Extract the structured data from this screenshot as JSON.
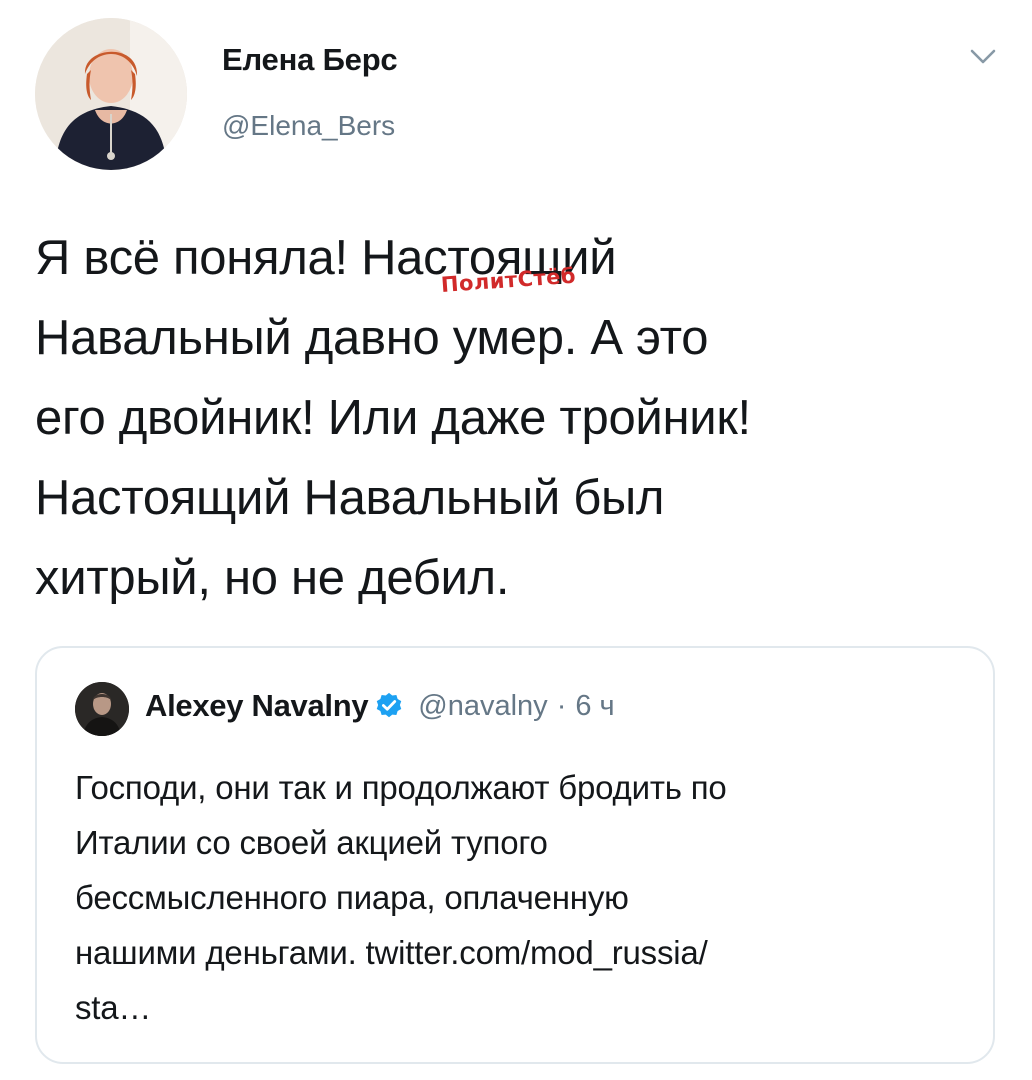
{
  "author": {
    "display_name": "Елена Берс",
    "handle": "@Elena_Bers"
  },
  "tweet": {
    "text": "Я всё поняла! Настоящий\nНавальный давно умер. А это\nего двойник! Или даже тройник!\nНастоящий Навальный был\nхитрый, но не дебил."
  },
  "watermark": {
    "text": "ПолитСтёб",
    "color": "#d12a2a"
  },
  "quoted_tweet": {
    "display_name": "Alexey Navalny",
    "handle": "@navalny",
    "separator": "·",
    "time": "6 ч",
    "text": "Господи, они так и продолжают бродить по\nИталии со своей акцией тупого\nбессмысленного пиара, оплаченную\nнашими деньгами. twitter.com/mod_russia/\nsta…",
    "verified_icon": "verified-badge-icon"
  },
  "icons": {
    "menu": "chevron-down-icon",
    "author_avatar": "avatar",
    "quoted_avatar": "avatar"
  },
  "colors": {
    "text_primary": "#14171a",
    "text_secondary": "#657786",
    "border": "#e1e8ed",
    "verified_blue": "#1da1f2"
  }
}
